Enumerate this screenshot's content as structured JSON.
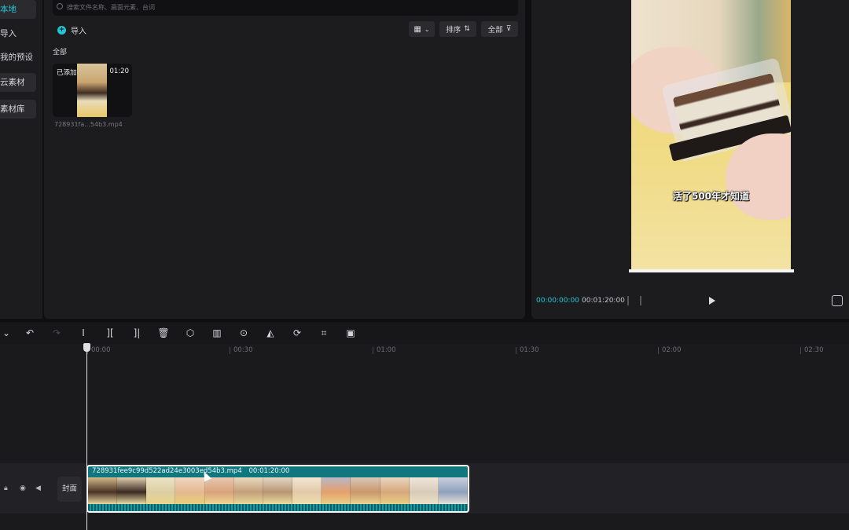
{
  "left_nav": {
    "items": [
      {
        "label": "本地",
        "active": true
      },
      {
        "label": "导入",
        "active": false
      },
      {
        "label": "我的预设",
        "active": false
      },
      {
        "label": "云素材",
        "active": false
      },
      {
        "label": "素材库",
        "active": false
      }
    ]
  },
  "media": {
    "search_placeholder": "搜索文件名称、画面元素、台词",
    "import_label": "导入",
    "sort_label": "排序",
    "filter_label": "全部",
    "category_label": "全部",
    "items": [
      {
        "added_label": "已添加",
        "duration": "01:20",
        "filename": "728931fa...54b3.mp4"
      }
    ]
  },
  "preview": {
    "subtitle": "活了500年才知道",
    "current_time": "00:00:00:00",
    "total_time": "00:01:20:00"
  },
  "toolbar": {
    "icons": [
      "dropdown-icon",
      "undo-icon",
      "redo-icon",
      "split-icon",
      "split-left-icon",
      "split-right-icon",
      "delete-icon",
      "mark-icon",
      "freeze-icon",
      "reverse-icon",
      "mirror-icon",
      "rotate-icon",
      "crop-icon",
      "smart-frame-icon"
    ]
  },
  "timeline": {
    "ruler": [
      "00:00",
      "00:30",
      "01:00",
      "01:30",
      "02:00",
      "02:30"
    ],
    "cover_label": "封面",
    "clip": {
      "name": "728931fee9c99d522ad24e3003ed54b3.mp4",
      "duration": "00:01:20:00"
    }
  },
  "colors": {
    "accent": "#21c6d6",
    "clip": "#11777e",
    "panel": "#1c1c1f",
    "background": "#0f0f11"
  }
}
